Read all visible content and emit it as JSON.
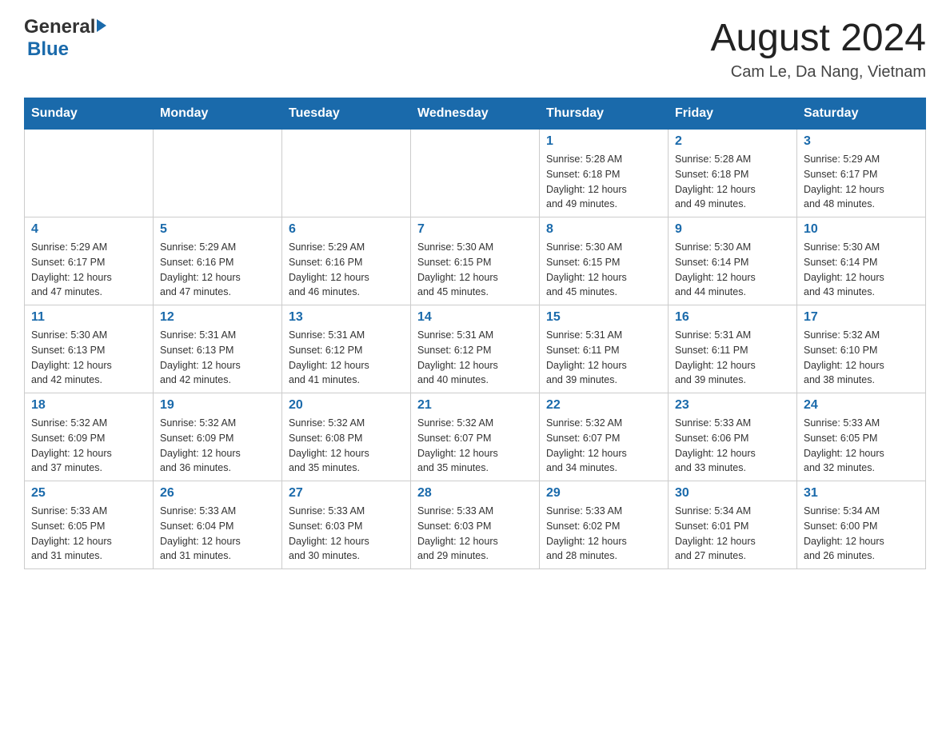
{
  "header": {
    "logo": {
      "general": "General",
      "blue": "Blue"
    },
    "title": "August 2024",
    "location": "Cam Le, Da Nang, Vietnam"
  },
  "days_of_week": [
    "Sunday",
    "Monday",
    "Tuesday",
    "Wednesday",
    "Thursday",
    "Friday",
    "Saturday"
  ],
  "weeks": [
    [
      {
        "day": "",
        "info": ""
      },
      {
        "day": "",
        "info": ""
      },
      {
        "day": "",
        "info": ""
      },
      {
        "day": "",
        "info": ""
      },
      {
        "day": "1",
        "info": "Sunrise: 5:28 AM\nSunset: 6:18 PM\nDaylight: 12 hours\nand 49 minutes."
      },
      {
        "day": "2",
        "info": "Sunrise: 5:28 AM\nSunset: 6:18 PM\nDaylight: 12 hours\nand 49 minutes."
      },
      {
        "day": "3",
        "info": "Sunrise: 5:29 AM\nSunset: 6:17 PM\nDaylight: 12 hours\nand 48 minutes."
      }
    ],
    [
      {
        "day": "4",
        "info": "Sunrise: 5:29 AM\nSunset: 6:17 PM\nDaylight: 12 hours\nand 47 minutes."
      },
      {
        "day": "5",
        "info": "Sunrise: 5:29 AM\nSunset: 6:16 PM\nDaylight: 12 hours\nand 47 minutes."
      },
      {
        "day": "6",
        "info": "Sunrise: 5:29 AM\nSunset: 6:16 PM\nDaylight: 12 hours\nand 46 minutes."
      },
      {
        "day": "7",
        "info": "Sunrise: 5:30 AM\nSunset: 6:15 PM\nDaylight: 12 hours\nand 45 minutes."
      },
      {
        "day": "8",
        "info": "Sunrise: 5:30 AM\nSunset: 6:15 PM\nDaylight: 12 hours\nand 45 minutes."
      },
      {
        "day": "9",
        "info": "Sunrise: 5:30 AM\nSunset: 6:14 PM\nDaylight: 12 hours\nand 44 minutes."
      },
      {
        "day": "10",
        "info": "Sunrise: 5:30 AM\nSunset: 6:14 PM\nDaylight: 12 hours\nand 43 minutes."
      }
    ],
    [
      {
        "day": "11",
        "info": "Sunrise: 5:30 AM\nSunset: 6:13 PM\nDaylight: 12 hours\nand 42 minutes."
      },
      {
        "day": "12",
        "info": "Sunrise: 5:31 AM\nSunset: 6:13 PM\nDaylight: 12 hours\nand 42 minutes."
      },
      {
        "day": "13",
        "info": "Sunrise: 5:31 AM\nSunset: 6:12 PM\nDaylight: 12 hours\nand 41 minutes."
      },
      {
        "day": "14",
        "info": "Sunrise: 5:31 AM\nSunset: 6:12 PM\nDaylight: 12 hours\nand 40 minutes."
      },
      {
        "day": "15",
        "info": "Sunrise: 5:31 AM\nSunset: 6:11 PM\nDaylight: 12 hours\nand 39 minutes."
      },
      {
        "day": "16",
        "info": "Sunrise: 5:31 AM\nSunset: 6:11 PM\nDaylight: 12 hours\nand 39 minutes."
      },
      {
        "day": "17",
        "info": "Sunrise: 5:32 AM\nSunset: 6:10 PM\nDaylight: 12 hours\nand 38 minutes."
      }
    ],
    [
      {
        "day": "18",
        "info": "Sunrise: 5:32 AM\nSunset: 6:09 PM\nDaylight: 12 hours\nand 37 minutes."
      },
      {
        "day": "19",
        "info": "Sunrise: 5:32 AM\nSunset: 6:09 PM\nDaylight: 12 hours\nand 36 minutes."
      },
      {
        "day": "20",
        "info": "Sunrise: 5:32 AM\nSunset: 6:08 PM\nDaylight: 12 hours\nand 35 minutes."
      },
      {
        "day": "21",
        "info": "Sunrise: 5:32 AM\nSunset: 6:07 PM\nDaylight: 12 hours\nand 35 minutes."
      },
      {
        "day": "22",
        "info": "Sunrise: 5:32 AM\nSunset: 6:07 PM\nDaylight: 12 hours\nand 34 minutes."
      },
      {
        "day": "23",
        "info": "Sunrise: 5:33 AM\nSunset: 6:06 PM\nDaylight: 12 hours\nand 33 minutes."
      },
      {
        "day": "24",
        "info": "Sunrise: 5:33 AM\nSunset: 6:05 PM\nDaylight: 12 hours\nand 32 minutes."
      }
    ],
    [
      {
        "day": "25",
        "info": "Sunrise: 5:33 AM\nSunset: 6:05 PM\nDaylight: 12 hours\nand 31 minutes."
      },
      {
        "day": "26",
        "info": "Sunrise: 5:33 AM\nSunset: 6:04 PM\nDaylight: 12 hours\nand 31 minutes."
      },
      {
        "day": "27",
        "info": "Sunrise: 5:33 AM\nSunset: 6:03 PM\nDaylight: 12 hours\nand 30 minutes."
      },
      {
        "day": "28",
        "info": "Sunrise: 5:33 AM\nSunset: 6:03 PM\nDaylight: 12 hours\nand 29 minutes."
      },
      {
        "day": "29",
        "info": "Sunrise: 5:33 AM\nSunset: 6:02 PM\nDaylight: 12 hours\nand 28 minutes."
      },
      {
        "day": "30",
        "info": "Sunrise: 5:34 AM\nSunset: 6:01 PM\nDaylight: 12 hours\nand 27 minutes."
      },
      {
        "day": "31",
        "info": "Sunrise: 5:34 AM\nSunset: 6:00 PM\nDaylight: 12 hours\nand 26 minutes."
      }
    ]
  ]
}
